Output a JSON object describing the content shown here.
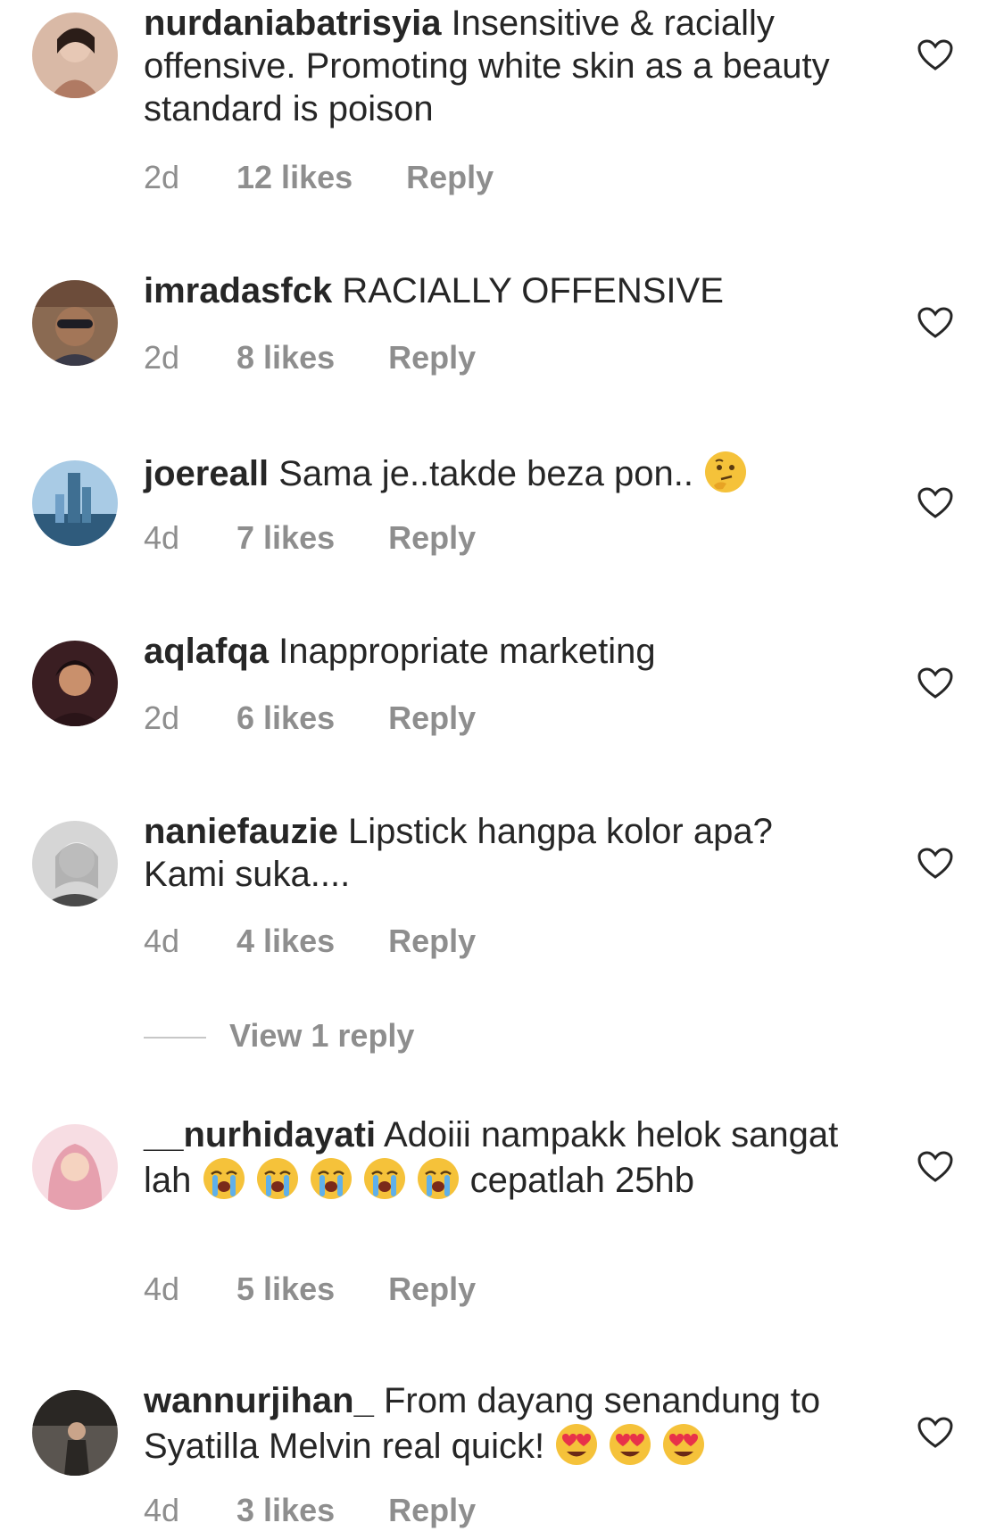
{
  "comments": [
    {
      "username": "nurdaniabatrisyia",
      "text": "Insensitive & racially offensive. Promoting white skin as a beauty standard is poison",
      "time": "2d",
      "likes": "12 likes",
      "reply": "Reply",
      "avatar_colors": [
        "#b07a63",
        "#e7c8b5"
      ]
    },
    {
      "username": "imradasfck",
      "text": "RACIALLY OFFENSIVE",
      "time": "2d",
      "likes": "8 likes",
      "reply": "Reply",
      "avatar_colors": [
        "#6c4c3a",
        "#3a3a48"
      ]
    },
    {
      "username": "joereall",
      "text": "Sama je..takde beza pon..",
      "emoji": [
        "thinking-face"
      ],
      "time": "4d",
      "likes": "7 likes",
      "reply": "Reply",
      "avatar_colors": [
        "#6f9fc7",
        "#2f5b7c"
      ]
    },
    {
      "username": "aqlafqa",
      "text": "Inappropriate marketing",
      "time": "2d",
      "likes": "6 likes",
      "reply": "Reply",
      "avatar_colors": [
        "#3a1e22",
        "#c9906c"
      ]
    },
    {
      "username": "naniefauzie",
      "text": "Lipstick hangpa kolor apa? Kami suka....",
      "time": "4d",
      "likes": "4 likes",
      "reply": "Reply",
      "avatar_colors": [
        "#d6d6d6",
        "#4a4a4a"
      ],
      "view_replies": "View 1 reply"
    },
    {
      "username": "__nurhidayati",
      "text": "Adoiii nampakk helok sangat lah",
      "emoji": [
        "loudly-crying-face",
        "loudly-crying-face",
        "loudly-crying-face",
        "loudly-crying-face",
        "loudly-crying-face"
      ],
      "text_after": "cepatlah 25hb",
      "time": "4d",
      "likes": "5 likes",
      "reply": "Reply",
      "avatar_colors": [
        "#f2c3cf",
        "#e6a0ae"
      ]
    },
    {
      "username": "wannurjihan_",
      "text": "From dayang senandung to Syatilla Melvin real quick!",
      "emoji": [
        "heart-eyes-face",
        "heart-eyes-face",
        "heart-eyes-face"
      ],
      "time": "4d",
      "likes": "3 likes",
      "reply": "Reply",
      "avatar_colors": [
        "#5a5550",
        "#2a2724"
      ]
    }
  ]
}
